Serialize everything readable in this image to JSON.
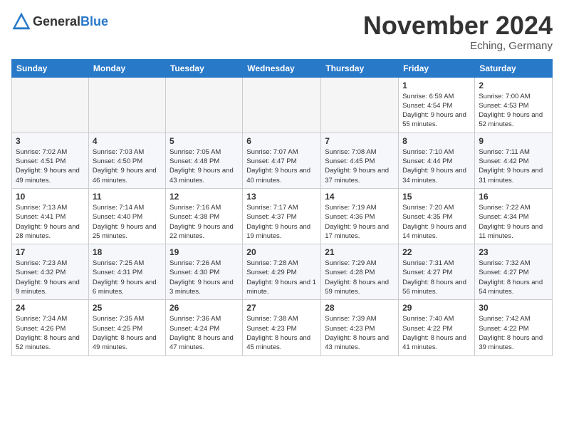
{
  "header": {
    "logo_general": "General",
    "logo_blue": "Blue",
    "month": "November 2024",
    "location": "Eching, Germany"
  },
  "weekdays": [
    "Sunday",
    "Monday",
    "Tuesday",
    "Wednesday",
    "Thursday",
    "Friday",
    "Saturday"
  ],
  "weeks": [
    [
      {
        "day": "",
        "info": ""
      },
      {
        "day": "",
        "info": ""
      },
      {
        "day": "",
        "info": ""
      },
      {
        "day": "",
        "info": ""
      },
      {
        "day": "",
        "info": ""
      },
      {
        "day": "1",
        "info": "Sunrise: 6:59 AM\nSunset: 4:54 PM\nDaylight: 9 hours and 55 minutes."
      },
      {
        "day": "2",
        "info": "Sunrise: 7:00 AM\nSunset: 4:53 PM\nDaylight: 9 hours and 52 minutes."
      }
    ],
    [
      {
        "day": "3",
        "info": "Sunrise: 7:02 AM\nSunset: 4:51 PM\nDaylight: 9 hours and 49 minutes."
      },
      {
        "day": "4",
        "info": "Sunrise: 7:03 AM\nSunset: 4:50 PM\nDaylight: 9 hours and 46 minutes."
      },
      {
        "day": "5",
        "info": "Sunrise: 7:05 AM\nSunset: 4:48 PM\nDaylight: 9 hours and 43 minutes."
      },
      {
        "day": "6",
        "info": "Sunrise: 7:07 AM\nSunset: 4:47 PM\nDaylight: 9 hours and 40 minutes."
      },
      {
        "day": "7",
        "info": "Sunrise: 7:08 AM\nSunset: 4:45 PM\nDaylight: 9 hours and 37 minutes."
      },
      {
        "day": "8",
        "info": "Sunrise: 7:10 AM\nSunset: 4:44 PM\nDaylight: 9 hours and 34 minutes."
      },
      {
        "day": "9",
        "info": "Sunrise: 7:11 AM\nSunset: 4:42 PM\nDaylight: 9 hours and 31 minutes."
      }
    ],
    [
      {
        "day": "10",
        "info": "Sunrise: 7:13 AM\nSunset: 4:41 PM\nDaylight: 9 hours and 28 minutes."
      },
      {
        "day": "11",
        "info": "Sunrise: 7:14 AM\nSunset: 4:40 PM\nDaylight: 9 hours and 25 minutes."
      },
      {
        "day": "12",
        "info": "Sunrise: 7:16 AM\nSunset: 4:38 PM\nDaylight: 9 hours and 22 minutes."
      },
      {
        "day": "13",
        "info": "Sunrise: 7:17 AM\nSunset: 4:37 PM\nDaylight: 9 hours and 19 minutes."
      },
      {
        "day": "14",
        "info": "Sunrise: 7:19 AM\nSunset: 4:36 PM\nDaylight: 9 hours and 17 minutes."
      },
      {
        "day": "15",
        "info": "Sunrise: 7:20 AM\nSunset: 4:35 PM\nDaylight: 9 hours and 14 minutes."
      },
      {
        "day": "16",
        "info": "Sunrise: 7:22 AM\nSunset: 4:34 PM\nDaylight: 9 hours and 11 minutes."
      }
    ],
    [
      {
        "day": "17",
        "info": "Sunrise: 7:23 AM\nSunset: 4:32 PM\nDaylight: 9 hours and 9 minutes."
      },
      {
        "day": "18",
        "info": "Sunrise: 7:25 AM\nSunset: 4:31 PM\nDaylight: 9 hours and 6 minutes."
      },
      {
        "day": "19",
        "info": "Sunrise: 7:26 AM\nSunset: 4:30 PM\nDaylight: 9 hours and 3 minutes."
      },
      {
        "day": "20",
        "info": "Sunrise: 7:28 AM\nSunset: 4:29 PM\nDaylight: 9 hours and 1 minute."
      },
      {
        "day": "21",
        "info": "Sunrise: 7:29 AM\nSunset: 4:28 PM\nDaylight: 8 hours and 59 minutes."
      },
      {
        "day": "22",
        "info": "Sunrise: 7:31 AM\nSunset: 4:27 PM\nDaylight: 8 hours and 56 minutes."
      },
      {
        "day": "23",
        "info": "Sunrise: 7:32 AM\nSunset: 4:27 PM\nDaylight: 8 hours and 54 minutes."
      }
    ],
    [
      {
        "day": "24",
        "info": "Sunrise: 7:34 AM\nSunset: 4:26 PM\nDaylight: 8 hours and 52 minutes."
      },
      {
        "day": "25",
        "info": "Sunrise: 7:35 AM\nSunset: 4:25 PM\nDaylight: 8 hours and 49 minutes."
      },
      {
        "day": "26",
        "info": "Sunrise: 7:36 AM\nSunset: 4:24 PM\nDaylight: 8 hours and 47 minutes."
      },
      {
        "day": "27",
        "info": "Sunrise: 7:38 AM\nSunset: 4:23 PM\nDaylight: 8 hours and 45 minutes."
      },
      {
        "day": "28",
        "info": "Sunrise: 7:39 AM\nSunset: 4:23 PM\nDaylight: 8 hours and 43 minutes."
      },
      {
        "day": "29",
        "info": "Sunrise: 7:40 AM\nSunset: 4:22 PM\nDaylight: 8 hours and 41 minutes."
      },
      {
        "day": "30",
        "info": "Sunrise: 7:42 AM\nSunset: 4:22 PM\nDaylight: 8 hours and 39 minutes."
      }
    ]
  ]
}
